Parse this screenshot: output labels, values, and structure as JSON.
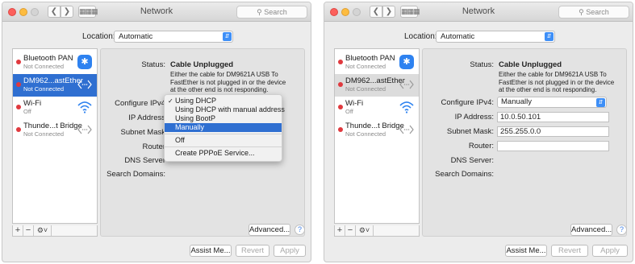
{
  "left_window": {
    "title": "Network",
    "search_placeholder": "Search",
    "location_label": "Location:",
    "location_value": "Automatic",
    "services": [
      {
        "name": "Bluetooth PAN",
        "status": "Not Connected"
      },
      {
        "name": "DM962...astEther",
        "status": "Not Connected"
      },
      {
        "name": "Wi-Fi",
        "status": "Off"
      },
      {
        "name": "Thunde...t Bridge",
        "status": "Not Connected"
      }
    ],
    "status_label": "Status:",
    "status_value": "Cable Unplugged",
    "status_desc": "Either the cable for DM9621A USB To FastEther is not plugged in or the device at the other end is not responding.",
    "configure_label": "Configure IPv4",
    "ip_label": "IP Address",
    "subnet_label": "Subnet Mask",
    "router_label": "Router",
    "dns_label": "DNS Server",
    "search_domains_label": "Search Domains:",
    "menu_items": [
      "Using DHCP",
      "Using DHCP with manual address",
      "Using BootP",
      "Manually",
      "Off",
      "Create PPPoE Service..."
    ],
    "advanced_label": "Advanced...",
    "assist_label": "Assist Me...",
    "revert_label": "Revert",
    "apply_label": "Apply"
  },
  "right_window": {
    "title": "Network",
    "search_placeholder": "Search",
    "location_label": "Location:",
    "location_value": "Automatic",
    "services": [
      {
        "name": "Bluetooth PAN",
        "status": "Not Connected"
      },
      {
        "name": "DM962...astEther",
        "status": "Not Connected"
      },
      {
        "name": "Wi-Fi",
        "status": "Off"
      },
      {
        "name": "Thunde...t Bridge",
        "status": "Not Connected"
      }
    ],
    "status_label": "Status:",
    "status_value": "Cable Unplugged",
    "status_desc": "Either the cable for DM9621A USB To FastEther is not plugged in or the device at the other end is not responding.",
    "configure_label": "Configure IPv4:",
    "configure_value": "Manually",
    "ip_label": "IP Address:",
    "ip_value": "10.0.50.101",
    "subnet_label": "Subnet Mask:",
    "subnet_value": "255.255.0.0",
    "router_label": "Router:",
    "router_value": "",
    "dns_label": "DNS Server:",
    "search_domains_label": "Search Domains:",
    "advanced_label": "Advanced...",
    "assist_label": "Assist Me...",
    "revert_label": "Revert",
    "apply_label": "Apply"
  },
  "icons": {
    "bluetooth": "bluetooth-icon",
    "ethernet": "ethernet-icon",
    "wifi": "wifi-icon",
    "help": "help-icon"
  },
  "colors": {
    "selection": "#2f6fd1",
    "status_dot": "#e0393e",
    "accent": "#3e8ff7"
  }
}
